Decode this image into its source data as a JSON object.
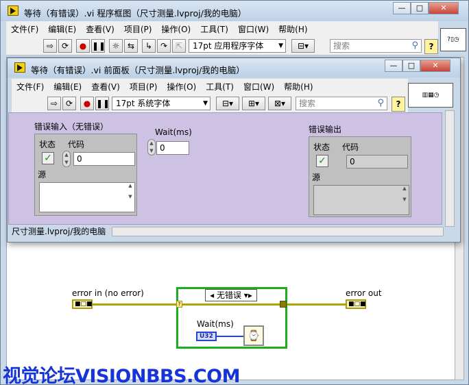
{
  "block_diagram": {
    "title": "等待（有错误）.vi 程序框图（尺寸测量.lvproj/我的电脑）",
    "window_buttons": [
      "—",
      "□",
      "✕"
    ],
    "menu": [
      "文件(F)",
      "编辑(E)",
      "查看(V)",
      "项目(P)",
      "操作(O)",
      "工具(T)",
      "窗口(W)",
      "帮助(H)"
    ],
    "font_combo": "17pt 应用程序字体",
    "search_placeholder": "搜索",
    "help": "?",
    "diagram": {
      "error_in_label": "error in (no error)",
      "error_out_label": "error out",
      "case_selector": "无错误",
      "wait_label": "Wait(ms)",
      "u32": "U32",
      "cluster_glyph": "■□■"
    }
  },
  "front_panel": {
    "title": "等待（有错误）.vi 前面板（尺寸测量.lvproj/我的电脑）",
    "window_buttons": [
      "—",
      "□",
      "✕"
    ],
    "menu": [
      "文件(F)",
      "编辑(E)",
      "查看(V)",
      "项目(P)",
      "操作(O)",
      "工具(T)",
      "窗口(W)",
      "帮助(H)"
    ],
    "font_combo": "17pt 系统字体",
    "search_placeholder": "搜索",
    "help": "?",
    "error_in": {
      "label": "错误输入（无错误）",
      "status_label": "状态",
      "code_label": "代码",
      "code_value": "0",
      "source_label": "源",
      "status_mark": "✓"
    },
    "wait": {
      "label": "Wait(ms)",
      "value": "0"
    },
    "error_out": {
      "label": "错误输出",
      "status_label": "状态",
      "code_label": "代码",
      "code_value": "0",
      "source_label": "源",
      "status_mark": "✓"
    },
    "status_path": "尺寸测量.lvproj/我的电脑"
  },
  "watermark": "视觉论坛VISIONBBS.COM"
}
